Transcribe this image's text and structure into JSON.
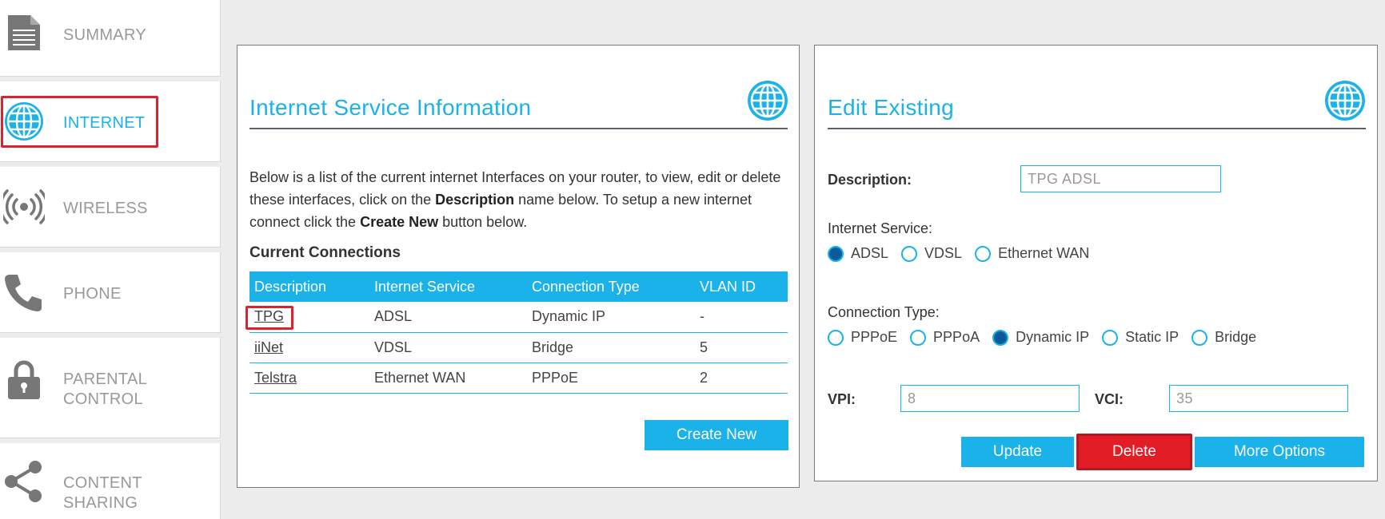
{
  "sidebar": {
    "items": [
      {
        "label": "SUMMARY",
        "icon": "document-icon"
      },
      {
        "label": "INTERNET",
        "icon": "globe-icon",
        "active": true
      },
      {
        "label": "WIRELESS",
        "icon": "wireless-signal-icon"
      },
      {
        "label": "PHONE",
        "icon": "phone-icon"
      },
      {
        "label": "PARENTAL\nCONTROL",
        "icon": "lock-icon"
      },
      {
        "label": "CONTENT\nSHARING",
        "icon": "share-icon"
      }
    ]
  },
  "info_panel": {
    "title": "Internet Service Information",
    "intro_pre": "Below is a list of the current internet Interfaces on your router, to view, edit or delete these interfaces, click on the ",
    "intro_bold1": "Description",
    "intro_mid": " name below. To setup a new internet connect click the ",
    "intro_bold2": "Create New",
    "intro_post": " button below.",
    "subheading": "Current Connections",
    "table": {
      "headers": [
        "Description",
        "Internet Service",
        "Connection Type",
        "VLAN ID"
      ],
      "rows": [
        [
          "TPG",
          "ADSL",
          "Dynamic IP",
          "-"
        ],
        [
          "iiNet",
          "VDSL",
          "Bridge",
          "5"
        ],
        [
          "Telstra",
          "Ethernet WAN",
          "PPPoE",
          "2"
        ]
      ]
    },
    "create_button": "Create New"
  },
  "edit_panel": {
    "title": "Edit Existing",
    "description_label": "Description:",
    "description_value": "TPG ADSL",
    "service_label": "Internet Service:",
    "service_options": [
      "ADSL",
      "VDSL",
      "Ethernet WAN"
    ],
    "service_selected": "ADSL",
    "connection_label": "Connection Type:",
    "connection_options": [
      "PPPoE",
      "PPPoA",
      "Dynamic IP",
      "Static IP",
      "Bridge"
    ],
    "connection_selected": "Dynamic IP",
    "vpi_label": "VPI:",
    "vpi_value": "8",
    "vci_label": "VCI:",
    "vci_value": "35",
    "update_button": "Update",
    "delete_button": "Delete",
    "more_button": "More Options"
  },
  "colors": {
    "accent": "#1ab2e8",
    "danger": "#e31d25",
    "highlight": "#d9232d"
  }
}
